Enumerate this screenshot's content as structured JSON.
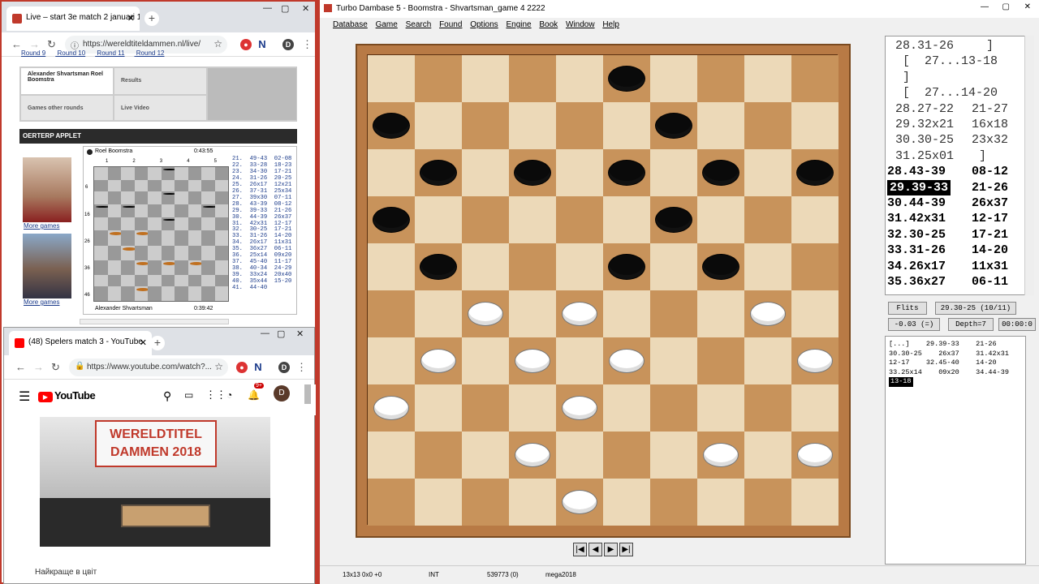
{
  "chrome1": {
    "tab_title": "Live – start 3e match 2 januari 1...",
    "url": "https://wereldtiteldammen.nl/live/",
    "rounds": [
      "Round 9",
      "Round 10",
      "Round 11",
      "Round 12"
    ],
    "player_tab": "Alexander Shvartsman Roel Boomstra",
    "results_tab": "Results",
    "games_other_tab": "Games other rounds",
    "live_video_tab": "Live Video",
    "applet_header": "OERTERP APPLET",
    "more_games_1": "More games",
    "more_games_2": "More games",
    "black_player": "Roel Boomstra",
    "black_clock": "0:43:55",
    "white_player": "Alexander Shvartsman",
    "white_clock": "0:39:42",
    "col_labels": [
      "1",
      "2",
      "3",
      "4",
      "5"
    ],
    "row_labels": [
      "6",
      "16",
      "26",
      "36",
      "46"
    ],
    "moves": "21.  49-43  02-08\n22.  33-28  18-23\n23.  34-30  17-21\n24.  31-26  20-25\n25.  26x17  12x21\n26.  37-31  25x34\n27.  39x30  07-11\n28.  43-39  08-12\n29.  39-33  21-26\n30.  44-39  26x37\n31.  42x31  12-17\n32.  30-25  17-21\n33.  31-26  14-20\n34.  26x17  11x31\n35.  36x27  06-11\n36.  25x14  09x20\n37.  45-40  11-17\n38.  40-34  24-29\n39.  33x24  20x40\n40.  35x44  15-20\n41.  44-40"
  },
  "chrome2": {
    "tab_title": "(48) Spelers match 3 - YouTube",
    "url": "https://www.youtube.com/watch?...",
    "yt_logo": "YouTube",
    "banner_line1": "WERELDTITEL",
    "banner_line2": "DAMMEN 2018",
    "notif_count": "9+",
    "avatar_letter": "D",
    "below_video": "Найкраще в цвіт"
  },
  "td": {
    "title": "Turbo Dambase 5 - Boomstra - Shvartsman_game 4 2222",
    "menu": [
      "Database",
      "Game",
      "Search",
      "Found",
      "Options",
      "Engine",
      "Book",
      "Window",
      "Help"
    ],
    "movelist": [
      {
        "n": "28.31-26",
        "a": "  ]"
      },
      {
        "n": " [  27...13-18",
        "a": ""
      },
      {
        "n": " ]",
        "a": ""
      },
      {
        "n": " [  27...14-20",
        "a": ""
      },
      {
        "n": "28.27-22",
        "a": "21-27"
      },
      {
        "n": "29.32x21",
        "a": "16x18"
      },
      {
        "n": "30.30-25",
        "a": "23x32"
      },
      {
        "n": "31.25x01",
        "a": " ]"
      },
      {
        "n": "28.43-39",
        "a": "08-12"
      },
      {
        "n": "29.39-33",
        "a": "21-26"
      },
      {
        "n": "30.44-39",
        "a": "26x37"
      },
      {
        "n": "31.42x31",
        "a": "12-17"
      },
      {
        "n": "32.30-25",
        "a": "17-21"
      },
      {
        "n": "33.31-26",
        "a": "14-20"
      },
      {
        "n": "34.26x17",
        "a": "11x31"
      },
      {
        "n": "35.36x27",
        "a": "06-11"
      }
    ],
    "flits": "Flits",
    "eval_move": "29.30-25 (10/11)",
    "score": "-0.03 (=)",
    "depth": "Depth=7",
    "time": "00:00:0",
    "analysis_lines": [
      "[...]    29.39-33    21-26",
      "30.30-25    26x37    31.42x31",
      "12-17    32.45-40    14-20",
      "33.25x14    09x20    34.44-39"
    ],
    "analysis_last": "13-18",
    "status": [
      "13x13  0x0  +0",
      "INT",
      "539773 (0)",
      "mega2018"
    ]
  },
  "colors": {
    "accent": "#c0392b",
    "board_dark": "#c8935b",
    "board_light": "#ecd9b8"
  }
}
